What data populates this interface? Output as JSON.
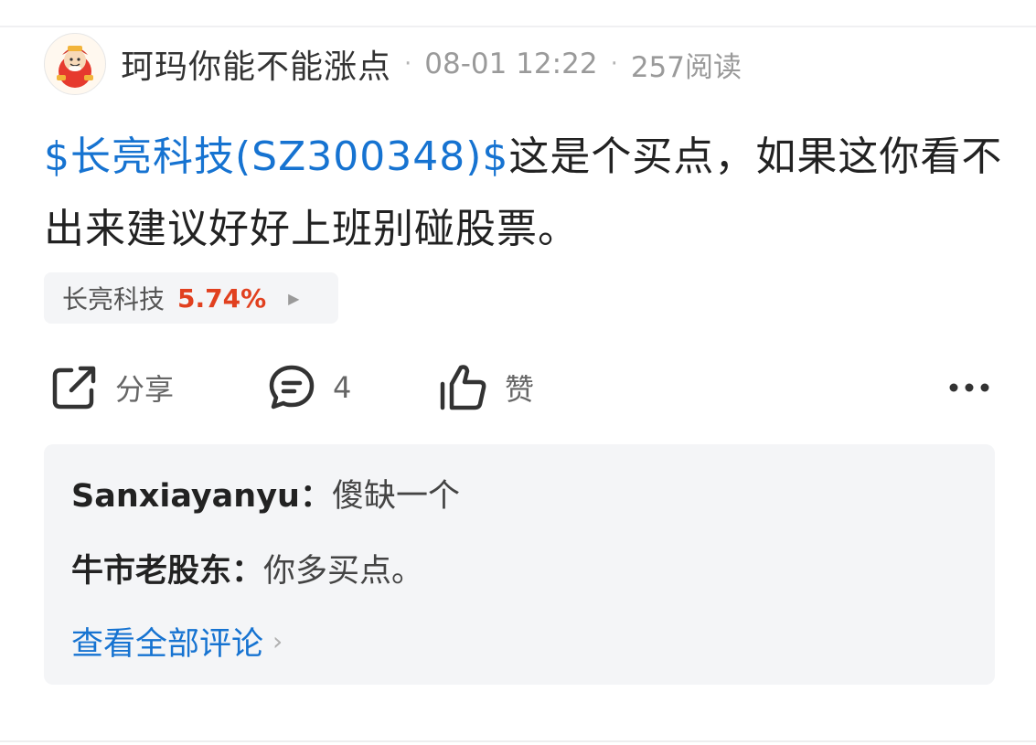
{
  "post": {
    "author": "珂玛你能不能涨点",
    "separator": "·",
    "time": "08-01 12:22",
    "reads": "257阅读",
    "body": {
      "stock_link": "$长亮科技(SZ300348)$",
      "text": "这是个买点，如果这你看不出来建议好好上班别碰股票。"
    },
    "stock_chip": {
      "name": "长亮科技",
      "change": "5.74%",
      "arrow": "▶"
    },
    "actions": {
      "share_label": "分享",
      "comment_count": "4",
      "like_label": "赞",
      "more_icon": "more-dots-icon"
    },
    "comments": [
      {
        "user": "Sanxiayanyu",
        "colon": "：",
        "text": "傻缺一个"
      },
      {
        "user": "牛市老股东",
        "colon": "：",
        "text": "你多买点。"
      }
    ],
    "view_all_label": "查看全部评论",
    "view_all_chevron": "›"
  },
  "colors": {
    "link_blue": "#1673d1",
    "rise_red": "#e1401f",
    "comment_bg": "#f4f5f7"
  }
}
